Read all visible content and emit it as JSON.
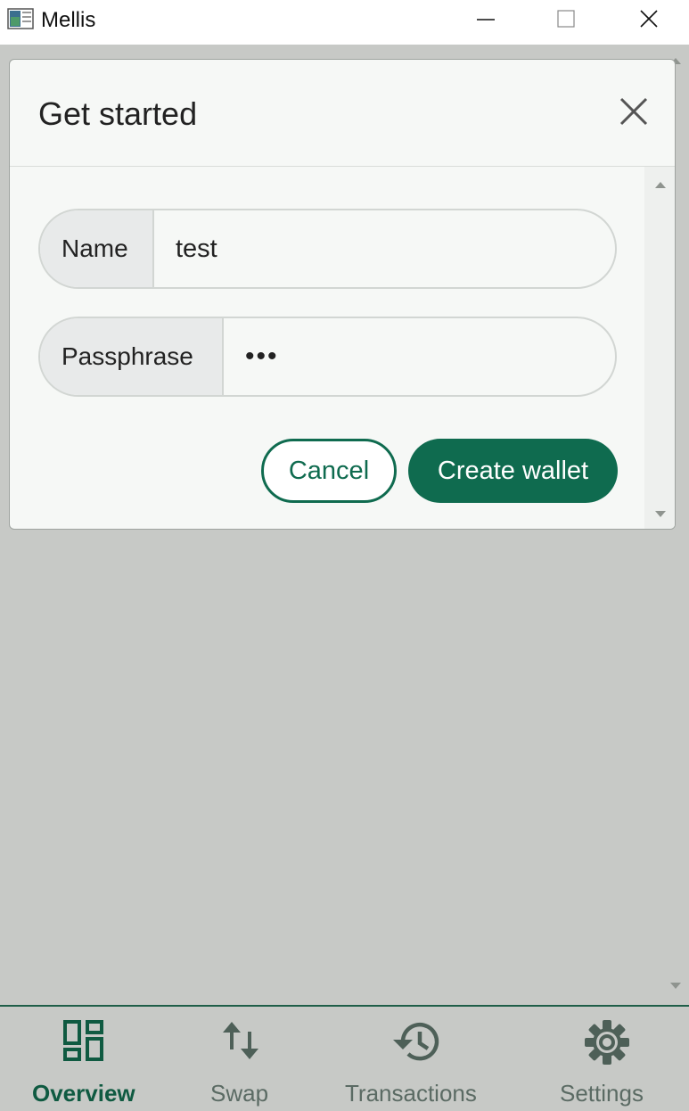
{
  "window": {
    "title": "Mellis"
  },
  "dialog": {
    "title": "Get started",
    "fields": {
      "name": {
        "label": "Name",
        "value": "test"
      },
      "passphrase": {
        "label": "Passphrase",
        "value": "•••"
      }
    },
    "cancel_label": "Cancel",
    "create_label": "Create wallet"
  },
  "nav": {
    "items": [
      {
        "label": "Overview",
        "icon": "overview-icon",
        "active": true
      },
      {
        "label": "Swap",
        "icon": "swap-icon",
        "active": false
      },
      {
        "label": "Transactions",
        "icon": "history-icon",
        "active": false
      },
      {
        "label": "Settings",
        "icon": "gear-icon",
        "active": false
      }
    ]
  },
  "colors": {
    "accent": "#0f6b4f",
    "background": "#c7c9c6",
    "nav_inactive": "#5b6b64"
  }
}
